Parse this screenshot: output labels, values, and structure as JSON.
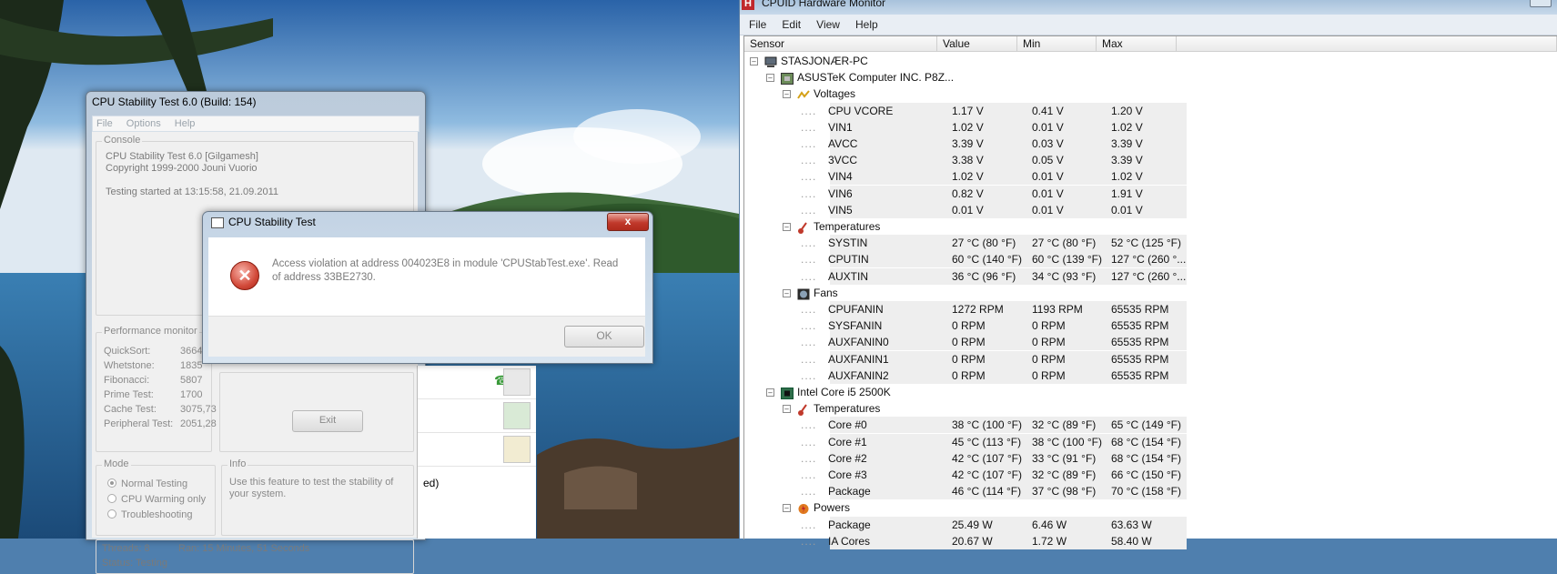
{
  "colors": {
    "hwm_stripe": "#eeeeee",
    "error_red": "#d24a3a",
    "titlebar_blue": "#c9d7e6"
  },
  "cpu_stability": {
    "title": "CPU Stability Test 6.0 (Build: 154)",
    "menu": [
      "File",
      "Options",
      "Help"
    ],
    "console": {
      "legend": "Console",
      "lines": [
        "CPU Stability Test 6.0 [Gilgamesh]",
        "Copyright 1999-2000 Jouni Vuorio",
        "",
        "Testing started at 13:15:58, 21.09.2011"
      ]
    },
    "performance": {
      "legend": "Performance monitor",
      "rows": [
        {
          "label": "QuickSort:",
          "value": "3664"
        },
        {
          "label": "Whetstone:",
          "value": "1835"
        },
        {
          "label": "Fibonacci:",
          "value": "5807"
        },
        {
          "label": "Prime Test:",
          "value": "1700"
        },
        {
          "label": "Cache Test:",
          "value": "3075,73"
        },
        {
          "label": "Peripheral Test:",
          "value": "2051,28"
        }
      ]
    },
    "exit_label": "Exit",
    "mode": {
      "legend": "Mode",
      "options": [
        "Normal Testing",
        "CPU Warming only",
        "Troubleshooting"
      ],
      "selected": "Normal Testing"
    },
    "info": {
      "legend": "Info",
      "text": "Use this feature to test the stability of your system."
    },
    "status": {
      "threads": "Threads:  8",
      "ran": "Ran:  15 Minutes, 51 Seconds",
      "status": "Status:  Testing"
    }
  },
  "background_window": {
    "partial_text": "ed)"
  },
  "error_dialog": {
    "title": "CPU Stability Test",
    "close_glyph": "x",
    "message": "Access violation at address 004023E8 in module 'CPUStabTest.exe'. Read of address 33BE2730.",
    "ok_label": "OK"
  },
  "hwmonitor": {
    "title": "CPUID Hardware Monitor",
    "logo": "H",
    "menu": [
      "File",
      "Edit",
      "View",
      "Help"
    ],
    "columns": [
      "Sensor",
      "Value",
      "Min",
      "Max"
    ],
    "rows": [
      {
        "kind": "root",
        "label": "STASJONÆR-PC",
        "icon": "computer-icon"
      },
      {
        "kind": "device",
        "label": "ASUSTeK Computer INC. P8Z...",
        "icon": "motherboard-icon"
      },
      {
        "kind": "group",
        "label": "Voltages",
        "icon": "voltage-icon"
      },
      {
        "kind": "item",
        "label": "CPU VCORE",
        "value": "1.17 V",
        "min": "0.41 V",
        "max": "1.20 V"
      },
      {
        "kind": "item",
        "label": "VIN1",
        "value": "1.02 V",
        "min": "0.01 V",
        "max": "1.02 V"
      },
      {
        "kind": "item",
        "label": "AVCC",
        "value": "3.39 V",
        "min": "0.03 V",
        "max": "3.39 V"
      },
      {
        "kind": "item",
        "label": "3VCC",
        "value": "3.38 V",
        "min": "0.05 V",
        "max": "3.39 V"
      },
      {
        "kind": "item",
        "label": "VIN4",
        "value": "1.02 V",
        "min": "0.01 V",
        "max": "1.02 V"
      },
      {
        "kind": "item",
        "label": "VIN6",
        "value": "0.82 V",
        "min": "0.01 V",
        "max": "1.91 V"
      },
      {
        "kind": "item",
        "label": "VIN5",
        "value": "0.01 V",
        "min": "0.01 V",
        "max": "0.01 V"
      },
      {
        "kind": "group",
        "label": "Temperatures",
        "icon": "thermometer-icon"
      },
      {
        "kind": "item",
        "label": "SYSTIN",
        "value": "27 °C  (80 °F)",
        "min": "27 °C  (80 °F)",
        "max": "52 °C  (125 °F)"
      },
      {
        "kind": "item",
        "label": "CPUTIN",
        "value": "60 °C  (140 °F)",
        "min": "60 °C  (139 °F)",
        "max": "127 °C  (260 °..."
      },
      {
        "kind": "item",
        "label": "AUXTIN",
        "value": "36 °C  (96 °F)",
        "min": "34 °C  (93 °F)",
        "max": "127 °C  (260 °..."
      },
      {
        "kind": "group",
        "label": "Fans",
        "icon": "fan-icon"
      },
      {
        "kind": "item",
        "label": "CPUFANIN",
        "value": "1272 RPM",
        "min": "1193 RPM",
        "max": "65535 RPM"
      },
      {
        "kind": "item",
        "label": "SYSFANIN",
        "value": "0 RPM",
        "min": "0 RPM",
        "max": "65535 RPM"
      },
      {
        "kind": "item",
        "label": "AUXFANIN0",
        "value": "0 RPM",
        "min": "0 RPM",
        "max": "65535 RPM"
      },
      {
        "kind": "item",
        "label": "AUXFANIN1",
        "value": "0 RPM",
        "min": "0 RPM",
        "max": "65535 RPM"
      },
      {
        "kind": "item",
        "label": "AUXFANIN2",
        "value": "0 RPM",
        "min": "0 RPM",
        "max": "65535 RPM"
      },
      {
        "kind": "device",
        "label": "Intel Core i5 2500K",
        "icon": "cpu-icon"
      },
      {
        "kind": "group",
        "label": "Temperatures",
        "icon": "thermometer-icon"
      },
      {
        "kind": "item",
        "label": "Core #0",
        "value": "38 °C  (100 °F)",
        "min": "32 °C  (89 °F)",
        "max": "65 °C  (149 °F)"
      },
      {
        "kind": "item",
        "label": "Core #1",
        "value": "45 °C  (113 °F)",
        "min": "38 °C  (100 °F)",
        "max": "68 °C  (154 °F)"
      },
      {
        "kind": "item",
        "label": "Core #2",
        "value": "42 °C  (107 °F)",
        "min": "33 °C  (91 °F)",
        "max": "68 °C  (154 °F)"
      },
      {
        "kind": "item",
        "label": "Core #3",
        "value": "42 °C  (107 °F)",
        "min": "32 °C  (89 °F)",
        "max": "66 °C  (150 °F)"
      },
      {
        "kind": "item",
        "label": "Package",
        "value": "46 °C  (114 °F)",
        "min": "37 °C  (98 °F)",
        "max": "70 °C  (158 °F)"
      },
      {
        "kind": "group",
        "label": "Powers",
        "icon": "power-icon"
      },
      {
        "kind": "item",
        "label": "Package",
        "value": "25.49 W",
        "min": "6.46 W",
        "max": "63.63 W"
      },
      {
        "kind": "item",
        "label": "IA Cores",
        "value": "20.67 W",
        "min": "1.72 W",
        "max": "58.40 W"
      }
    ]
  }
}
